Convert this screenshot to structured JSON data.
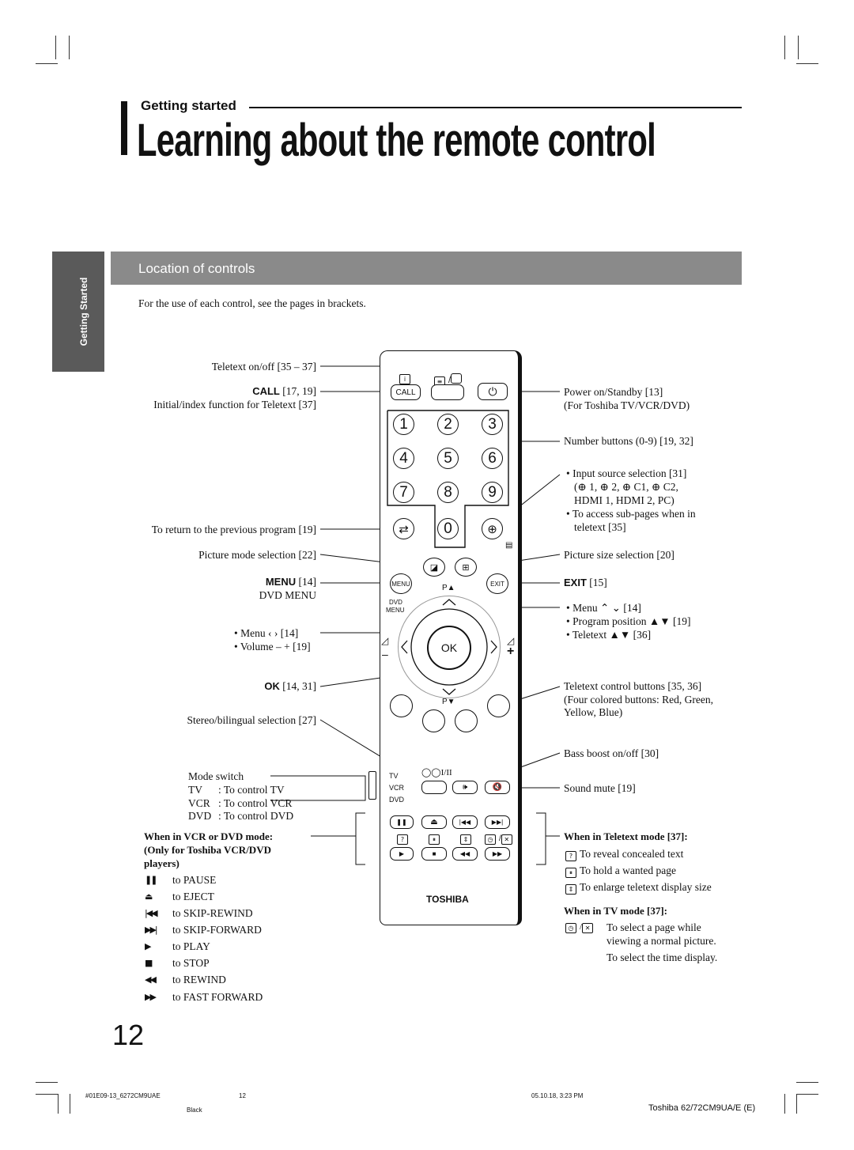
{
  "header": {
    "section": "Getting started",
    "title": "Learning about the remote control"
  },
  "side_tab": "Getting Started",
  "section_bar": "Location of controls",
  "intro": "For the use of each control, see the pages in brackets.",
  "left_labels": {
    "teletext_onoff": "Teletext on/off [35 – 37]",
    "call_key": "CALL",
    "call_ref": " [17, 19]",
    "initial_index": "Initial/index function for Teletext [37]",
    "return_prev": "To return to the previous program [19]",
    "picture_mode": "Picture mode selection [22]",
    "menu_key": "MENU",
    "menu_ref": " [14]",
    "dvd_menu": "DVD MENU",
    "menu_lr": "• Menu ‹ › [14]",
    "volume": "• Volume – + [19]",
    "ok_key": "OK",
    "ok_ref": " [14, 31]",
    "stereo": "Stereo/bilingual selection [27]",
    "mode_switch": "Mode switch",
    "modes": [
      {
        "key": "TV",
        "desc": ": To control TV"
      },
      {
        "key": "VCR",
        "desc": ": To control VCR"
      },
      {
        "key": "DVD",
        "desc": ": To control DVD"
      }
    ]
  },
  "vcr_dvd": {
    "heading_1": "When in VCR or DVD mode:",
    "heading_2": "(Only for Toshiba VCR/DVD",
    "heading_3": "players)",
    "items": [
      {
        "icon": "pause",
        "glyph": "❚❚",
        "label": "to PAUSE"
      },
      {
        "icon": "eject",
        "glyph": "⏏",
        "label": "to EJECT"
      },
      {
        "icon": "skip-rewind",
        "glyph": "|◀◀",
        "label": "to SKIP-REWIND"
      },
      {
        "icon": "skip-forward",
        "glyph": "▶▶|",
        "label": "to SKIP-FORWARD"
      },
      {
        "icon": "play",
        "glyph": "▶",
        "label": "to PLAY"
      },
      {
        "icon": "stop",
        "glyph": "■",
        "label": "to STOP"
      },
      {
        "icon": "rewind",
        "glyph": "◀◀",
        "label": "to REWIND"
      },
      {
        "icon": "fast-forward",
        "glyph": "▶▶",
        "label": "to FAST FORWARD"
      }
    ]
  },
  "right_labels": {
    "power": "Power on/Standby [13]",
    "power_sub": "(For Toshiba TV/VCR/DVD)",
    "number_key": "Number",
    "number_ref": " buttons (0-9) [19, 32]",
    "input_1": "• Input source selection [31]",
    "input_2": "(⊕ 1, ⊕ 2, ⊕ C1, ⊕ C2,",
    "input_3": "HDMI 1, HDMI 2, PC)",
    "input_4": "• To access sub-pages when in",
    "input_5": "teletext  [35]",
    "picture_size": "Picture size selection [20]",
    "exit_key": "EXIT",
    "exit_ref": " [15]",
    "menu_ud": "• Menu ⌃ ⌄ [14]",
    "program_pos": "• Program position ▲▼ [19]",
    "teletext_ud": "• Teletext ▲▼ [36]",
    "teletext_ctrl_1": "Teletext control buttons [35, 36]",
    "teletext_ctrl_2": "(Four colored buttons: Red, Green,",
    "teletext_ctrl_3": "Yellow, Blue)",
    "bass": "Bass boost on/off [30]",
    "mute": "Sound mute [19]"
  },
  "teletext_mode": {
    "heading": "When in Teletext mode [37]:",
    "items": [
      {
        "icon": "reveal",
        "glyph": "?",
        "label": "To reveal concealed text"
      },
      {
        "icon": "hold",
        "glyph": "⏸",
        "label": "To hold a wanted page"
      },
      {
        "icon": "enlarge",
        "glyph": "⇕",
        "label": "To enlarge teletext display size"
      }
    ]
  },
  "tv_mode": {
    "heading": "When in TV mode [37]:",
    "line_1": "To select a page while",
    "line_2": "viewing a normal picture.",
    "line_3": "To select the time display."
  },
  "remote": {
    "call": "CALL",
    "digits": [
      "1",
      "2",
      "3",
      "4",
      "5",
      "6",
      "7",
      "8",
      "9",
      "0"
    ],
    "menu": "MENU",
    "exit": "EXIT",
    "p_up": "P▲",
    "p_down": "P▼",
    "dvd_menu_1": "DVD",
    "dvd_menu_2": "MENU",
    "ok": "OK",
    "stereo": "I/II",
    "mode_tv": "TV",
    "mode_vcr": "VCR",
    "mode_dvd": "DVD",
    "brand": "TOSHIBA",
    "colors": {
      "red": "#ffffff",
      "green": "#ffffff",
      "yellow": "#ffffff",
      "blue": "#ffffff"
    }
  },
  "page_number": "12",
  "footer": {
    "file": "#01E09-13_6272CM9UAE",
    "page": "12",
    "date": "05.10.18, 3:23 PM",
    "color": "Black",
    "model": "Toshiba 62/72CM9UA/E (E)"
  },
  "colors": {
    "section_bar": "#8a8a8a",
    "side_tab": "#5a5a5a",
    "text": "#111111"
  }
}
